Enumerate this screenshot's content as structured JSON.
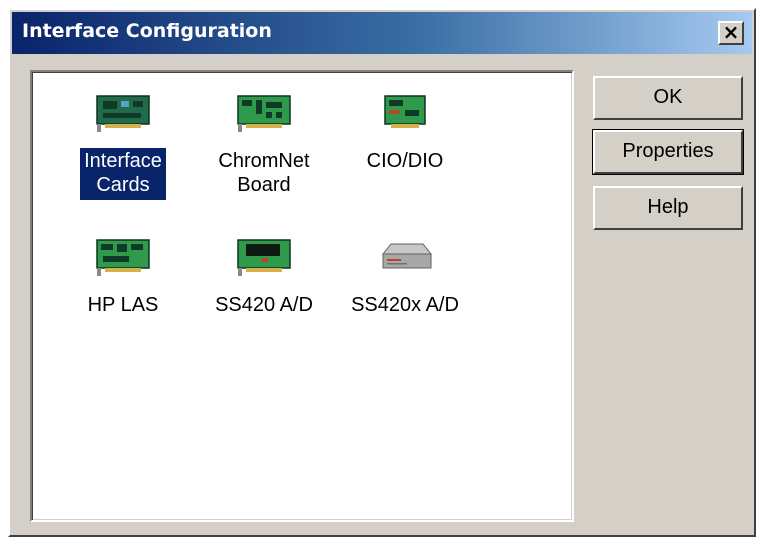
{
  "window": {
    "title": "Interface Configuration",
    "close_label": "×"
  },
  "items": [
    {
      "label_line1": "Interface",
      "label_line2": "Cards",
      "icon": "interface-card-icon",
      "selected": true
    },
    {
      "label_line1": "ChromNet",
      "label_line2": "Board",
      "icon": "chromnet-board-icon",
      "selected": false
    },
    {
      "label_line1": "CIO/DIO",
      "label_line2": "",
      "icon": "cio-dio-card-icon",
      "selected": false
    },
    {
      "label_line1": "HP LAS",
      "label_line2": "",
      "icon": "hp-las-card-icon",
      "selected": false
    },
    {
      "label_line1": "SS420 A/D",
      "label_line2": "",
      "icon": "ss420-card-icon",
      "selected": false
    },
    {
      "label_line1": "SS420x A/D",
      "label_line2": "",
      "icon": "ss420x-device-icon",
      "selected": false
    }
  ],
  "buttons": {
    "ok": "OK",
    "properties": "Properties",
    "help": "Help"
  },
  "colors": {
    "dialog_face": "#d4d0c8",
    "title_gradient_start": "#0a246a",
    "title_gradient_end": "#a6caf0",
    "selection": "#0a246a",
    "card_green": "#2e8b57"
  }
}
